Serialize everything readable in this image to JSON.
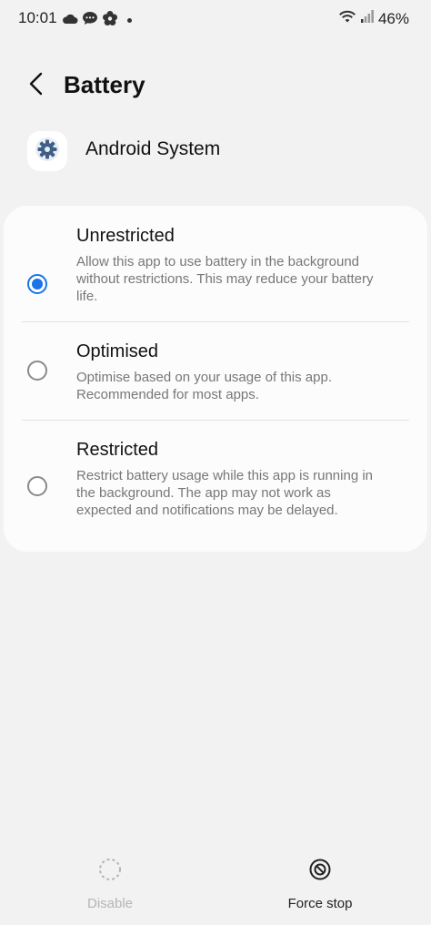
{
  "status_bar": {
    "time": "10:01",
    "battery": "46%",
    "notification_icons": [
      "cloud-icon",
      "chat-icon",
      "flower-icon"
    ],
    "right_icons": [
      "wifi-icon",
      "signal-icon"
    ]
  },
  "header": {
    "title": "Battery",
    "back_icon": "back-arrow-icon"
  },
  "app": {
    "name": "Android System",
    "icon": "gear-icon"
  },
  "options": [
    {
      "title": "Unrestricted",
      "description": "Allow this app to use battery in the background without restrictions. This may reduce your battery life.",
      "selected": true
    },
    {
      "title": "Optimised",
      "description": "Optimise based on your usage of this app. Recommended for most apps.",
      "selected": false
    },
    {
      "title": "Restricted",
      "description": "Restrict battery usage while this app is running in the background. The app may not work as expected and notifications may be delayed.",
      "selected": false
    }
  ],
  "bottom_actions": {
    "disable_label": "Disable",
    "force_stop_label": "Force stop"
  },
  "colors": {
    "accent": "#1a73e8",
    "background": "#f2f2f2",
    "card": "#fcfcfc"
  }
}
